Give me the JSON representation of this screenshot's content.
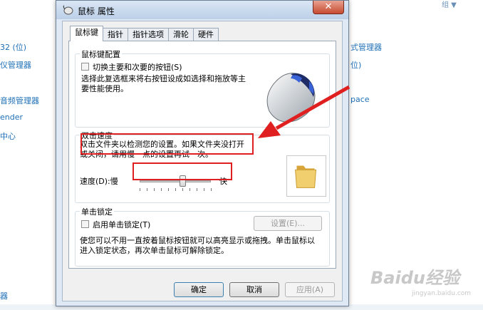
{
  "background": {
    "left_items": [
      "32 (位)",
      "仪管理器",
      "音频管理器",
      "ender",
      "中心",
      "器"
    ],
    "right_items": [
      "式管理器",
      "位)",
      "pace"
    ],
    "top_right": "组 ▼"
  },
  "dialog": {
    "title": "鼠标 属性",
    "close_glyph": "✕",
    "tabs": [
      "鼠标键",
      "指针",
      "指针选项",
      "滑轮",
      "硬件"
    ],
    "button_config": {
      "group_title": "鼠标键配置",
      "checkbox_label": "切换主要和次要的按钮(S)",
      "description": "选择此复选框来将右按钮设成如选择和拖放等主要性能使用。"
    },
    "double_click": {
      "group_title": "双击速度",
      "description": "双击文件夹以检测您的设置。如果文件夹没打开或关闭，请用慢一点的设置再试一次。",
      "speed_label": "速度(D):慢",
      "fast_label": "快",
      "slider_value": 0.6
    },
    "click_lock": {
      "group_title": "单击锁定",
      "checkbox_label": "启用单击锁定(T)",
      "settings_button": "设置(E)...",
      "description": "使您可以不用一直按着鼠标按钮就可以高亮显示或拖拽。单击鼠标以进入锁定状态，再次单击鼠标可解除锁定。"
    },
    "buttons": {
      "ok": "确定",
      "cancel": "取消",
      "apply": "应用(A)"
    }
  },
  "watermark": {
    "text": "Baidu经验",
    "sub": "jingyan.baidu.com"
  },
  "colors": {
    "annotation": "#e02020",
    "link": "#1e6fb6"
  }
}
